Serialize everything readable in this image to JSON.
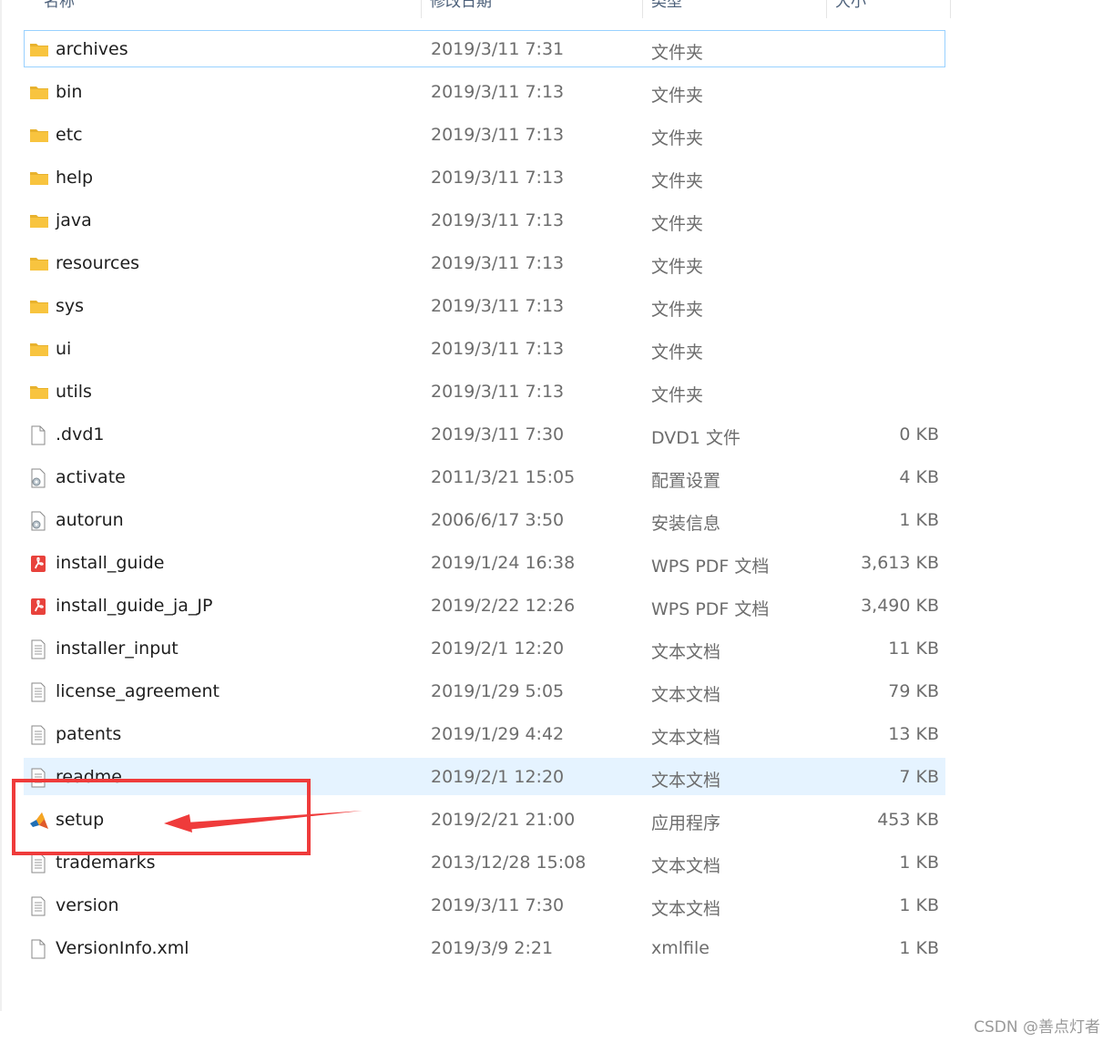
{
  "header": {
    "name": "名称",
    "date": "修改日期",
    "type": "类型",
    "size": "大小"
  },
  "files": [
    {
      "name": "archives",
      "date": "2019/3/11 7:31",
      "type": "文件夹",
      "size": "",
      "icon": "folder-icon",
      "state": "selected"
    },
    {
      "name": "bin",
      "date": "2019/3/11 7:13",
      "type": "文件夹",
      "size": "",
      "icon": "folder-icon",
      "state": ""
    },
    {
      "name": "etc",
      "date": "2019/3/11 7:13",
      "type": "文件夹",
      "size": "",
      "icon": "folder-icon",
      "state": ""
    },
    {
      "name": "help",
      "date": "2019/3/11 7:13",
      "type": "文件夹",
      "size": "",
      "icon": "folder-icon",
      "state": ""
    },
    {
      "name": "java",
      "date": "2019/3/11 7:13",
      "type": "文件夹",
      "size": "",
      "icon": "folder-icon",
      "state": ""
    },
    {
      "name": "resources",
      "date": "2019/3/11 7:13",
      "type": "文件夹",
      "size": "",
      "icon": "folder-icon",
      "state": ""
    },
    {
      "name": "sys",
      "date": "2019/3/11 7:13",
      "type": "文件夹",
      "size": "",
      "icon": "folder-icon",
      "state": ""
    },
    {
      "name": "ui",
      "date": "2019/3/11 7:13",
      "type": "文件夹",
      "size": "",
      "icon": "folder-icon",
      "state": ""
    },
    {
      "name": "utils",
      "date": "2019/3/11 7:13",
      "type": "文件夹",
      "size": "",
      "icon": "folder-icon",
      "state": ""
    },
    {
      "name": ".dvd1",
      "date": "2019/3/11 7:30",
      "type": "DVD1 文件",
      "size": "0 KB",
      "icon": "blank-file-icon",
      "state": ""
    },
    {
      "name": "activate",
      "date": "2011/3/21 15:05",
      "type": "配置设置",
      "size": "4 KB",
      "icon": "settings-file-icon",
      "state": ""
    },
    {
      "name": "autorun",
      "date": "2006/6/17 3:50",
      "type": "安装信息",
      "size": "1 KB",
      "icon": "settings-file-icon",
      "state": ""
    },
    {
      "name": "install_guide",
      "date": "2019/1/24 16:38",
      "type": "WPS PDF 文档",
      "size": "3,613 KB",
      "icon": "pdf-file-icon",
      "state": ""
    },
    {
      "name": "install_guide_ja_JP",
      "date": "2019/2/22 12:26",
      "type": "WPS PDF 文档",
      "size": "3,490 KB",
      "icon": "pdf-file-icon",
      "state": ""
    },
    {
      "name": "installer_input",
      "date": "2019/2/1 12:20",
      "type": "文本文档",
      "size": "11 KB",
      "icon": "text-file-icon",
      "state": ""
    },
    {
      "name": "license_agreement",
      "date": "2019/1/29 5:05",
      "type": "文本文档",
      "size": "79 KB",
      "icon": "text-file-icon",
      "state": ""
    },
    {
      "name": "patents",
      "date": "2019/1/29 4:42",
      "type": "文本文档",
      "size": "13 KB",
      "icon": "text-file-icon",
      "state": ""
    },
    {
      "name": "readme",
      "date": "2019/2/1 12:20",
      "type": "文本文档",
      "size": "7 KB",
      "icon": "text-file-icon",
      "state": "hover"
    },
    {
      "name": "setup",
      "date": "2019/2/21 21:00",
      "type": "应用程序",
      "size": "453 KB",
      "icon": "matlab-app-icon",
      "state": ""
    },
    {
      "name": "trademarks",
      "date": "2013/12/28 15:08",
      "type": "文本文档",
      "size": "1 KB",
      "icon": "text-file-icon",
      "state": ""
    },
    {
      "name": "version",
      "date": "2019/3/11 7:30",
      "type": "文本文档",
      "size": "1 KB",
      "icon": "text-file-icon",
      "state": ""
    },
    {
      "name": "VersionInfo.xml",
      "date": "2019/3/9 2:21",
      "type": "xmlfile",
      "size": "1 KB",
      "icon": "blank-file-icon",
      "state": ""
    }
  ],
  "annotation": {
    "color": "#ef3b3b"
  },
  "watermark": "CSDN @善点灯者",
  "colors": {
    "selection_border": "#99d1ff",
    "hover_background": "#e5f3ff",
    "folder": "#f8c43f"
  }
}
